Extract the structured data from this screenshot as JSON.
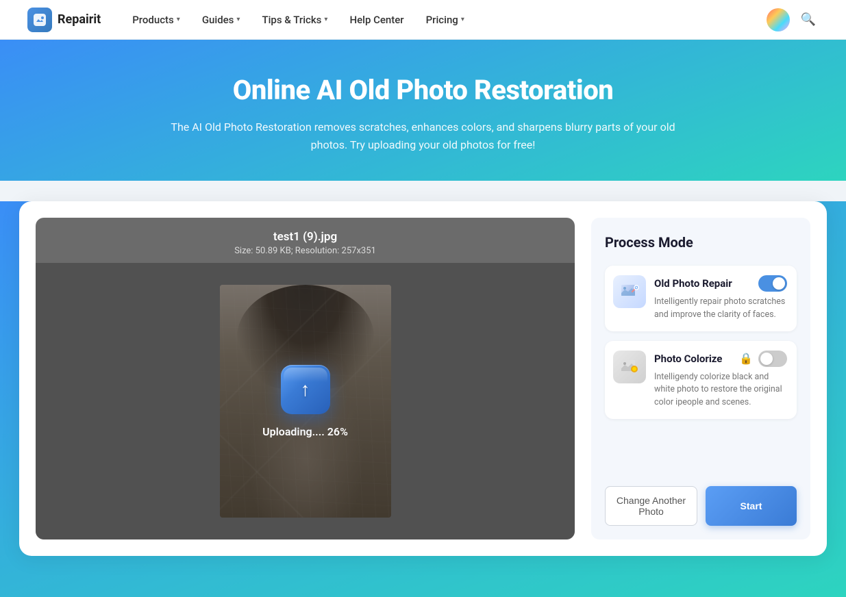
{
  "nav": {
    "logo_text": "Repairit",
    "logo_icon": "R",
    "items": [
      {
        "label": "Products",
        "has_dropdown": true
      },
      {
        "label": "Guides",
        "has_dropdown": true
      },
      {
        "label": "Tips & Tricks",
        "has_dropdown": true
      },
      {
        "label": "Help Center",
        "has_dropdown": false
      },
      {
        "label": "Pricing",
        "has_dropdown": true
      }
    ]
  },
  "hero": {
    "title": "Online AI Old Photo Restoration",
    "description": "The AI Old Photo Restoration removes scratches, enhances colors, and sharpens blurry parts of your old photos. Try uploading your old photos for free!"
  },
  "photo_area": {
    "filename": "test1 (9).jpg",
    "meta": "Size: 50.89 KB; Resolution: 257x351",
    "upload_text": "Uploading.... 26%"
  },
  "process_panel": {
    "title": "Process Mode",
    "modes": [
      {
        "name": "Old Photo Repair",
        "description": "Intelligently repair photo scratches and improve the clarity of faces.",
        "enabled": true,
        "has_lock": false,
        "icon": "🖼"
      },
      {
        "name": "Photo Colorize",
        "description": "Intelligendy colorize black and white photo to restore the original color ipeople and scenes.",
        "enabled": false,
        "has_lock": true,
        "icon": "🎨"
      }
    ],
    "buttons": {
      "change": "Change Another Photo",
      "start": "Start"
    }
  }
}
